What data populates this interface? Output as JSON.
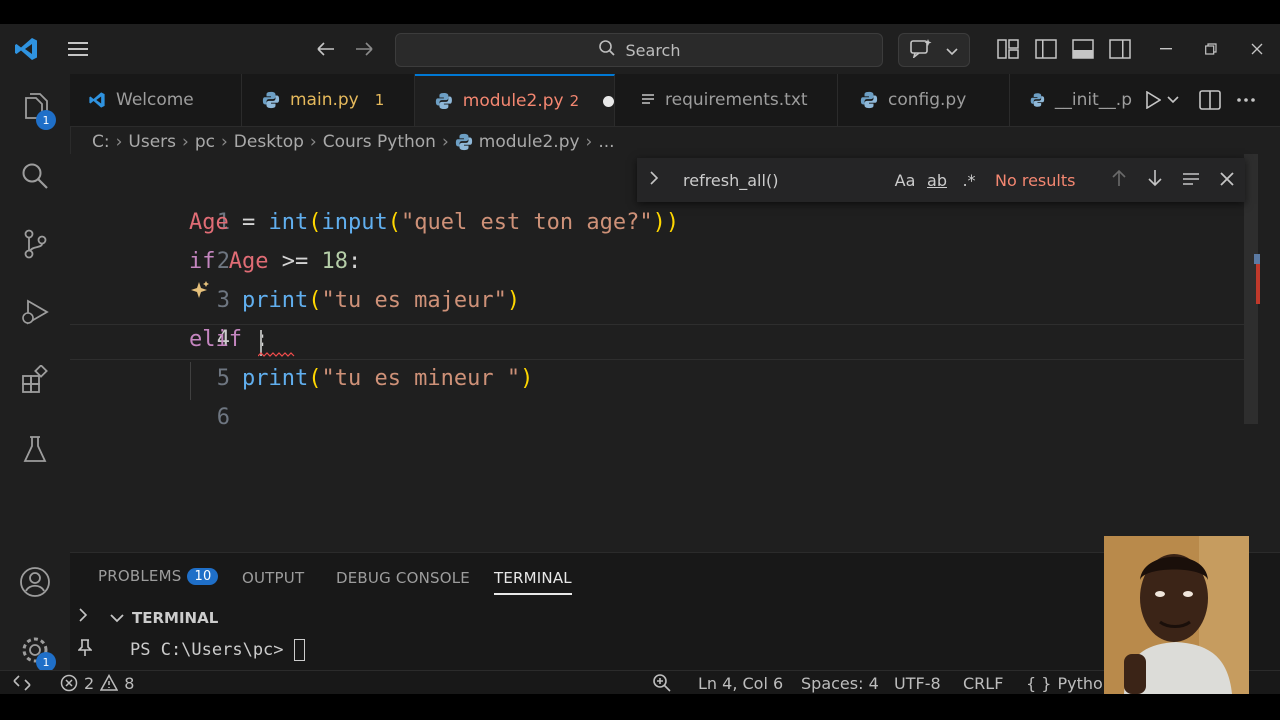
{
  "titlebar": {
    "search_placeholder": "Search"
  },
  "activity": {
    "explorer_badge": "1",
    "settings_badge": "1"
  },
  "tabs": [
    {
      "label": "Welcome",
      "badge": ""
    },
    {
      "label": "main.py",
      "badge": "1"
    },
    {
      "label": "module2.py",
      "badge": "2"
    },
    {
      "label": "requirements.txt",
      "badge": ""
    },
    {
      "label": "config.py",
      "badge": ""
    },
    {
      "label": "__init__.p",
      "badge": ""
    }
  ],
  "breadcrumb": [
    "C:",
    "Users",
    "pc",
    "Desktop",
    "Cours Python",
    "module2.py",
    "..."
  ],
  "find": {
    "query": "refresh_all()",
    "match_case": "Aa",
    "whole_word": "ab",
    "regex": ".*",
    "result": "No results"
  },
  "editor": {
    "line_numbers": [
      "1",
      "2",
      "3",
      "4",
      "5",
      "6"
    ],
    "lines": [
      [
        [
          "var",
          "Age"
        ],
        [
          "op",
          " = "
        ],
        [
          "fn",
          "int"
        ],
        [
          "pn",
          "("
        ],
        [
          "fn",
          "input"
        ],
        [
          "pn",
          "("
        ],
        [
          "str",
          "\"quel est ton age?\""
        ],
        [
          "pn",
          "))"
        ]
      ],
      [
        [
          "kw",
          "if"
        ],
        [
          "op",
          " "
        ],
        [
          "var",
          "Age"
        ],
        [
          "op",
          " >= "
        ],
        [
          "num",
          "18"
        ],
        [
          "op",
          ":"
        ]
      ],
      [
        [
          "op",
          "    "
        ],
        [
          "fn",
          "print"
        ],
        [
          "pn",
          "("
        ],
        [
          "str",
          "\"tu es majeur\""
        ],
        [
          "pn",
          ")"
        ]
      ],
      [
        [
          "kw",
          "elif"
        ],
        [
          "op",
          " :"
        ]
      ],
      [
        [
          "op",
          "    "
        ],
        [
          "fn",
          "print"
        ],
        [
          "pn",
          "("
        ],
        [
          "str",
          "\"tu es mineur \""
        ],
        [
          "pn",
          ")"
        ]
      ],
      []
    ]
  },
  "panel": {
    "tabs": [
      "PROBLEMS",
      "OUTPUT",
      "DEBUG CONSOLE",
      "TERMINAL"
    ],
    "problems_count": "10",
    "terminal_header": "TERMINAL",
    "prompt": "PS C:\\Users\\pc> "
  },
  "status": {
    "errors": "2",
    "warnings": "8",
    "position": "Ln 4, Col 6",
    "spaces": "Spaces: 4",
    "encoding": "UTF-8",
    "eol": "CRLF",
    "language": "Python"
  }
}
